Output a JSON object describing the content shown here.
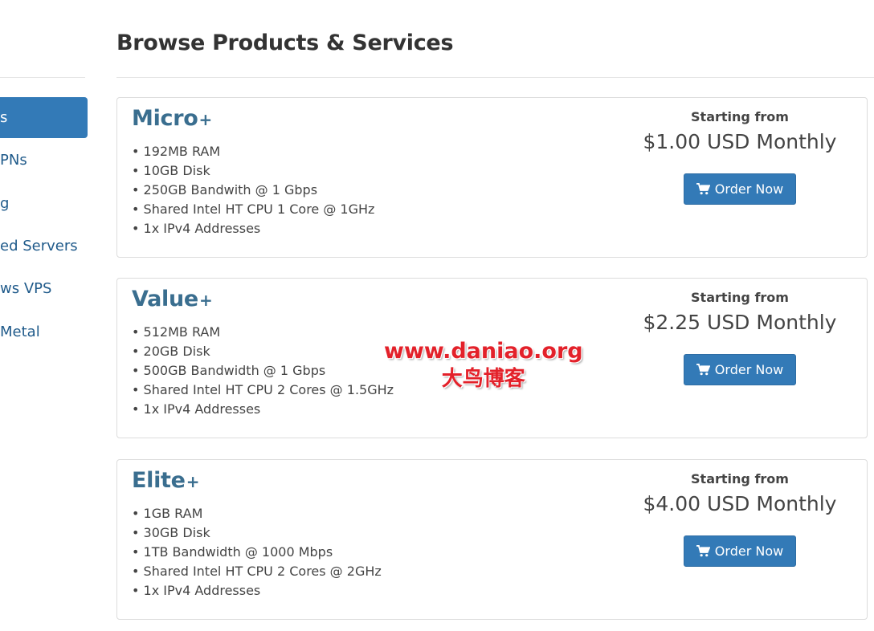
{
  "sidebar": {
    "items": [
      {
        "label": "s",
        "active": true
      },
      {
        "label": "PNs",
        "active": false
      },
      {
        "label": "g",
        "active": false
      },
      {
        "label": "ed Servers",
        "active": false
      },
      {
        "label": "ws VPS",
        "active": false
      },
      {
        "label": "Metal",
        "active": false
      }
    ]
  },
  "page": {
    "title": "Browse Products & Services"
  },
  "products": [
    {
      "name": "Micro",
      "name_suffix": "+",
      "features": [
        "192MB RAM",
        "10GB Disk",
        "250GB Bandwith @ 1 Gbps",
        "Shared Intel HT CPU 1 Core @ 1GHz",
        "1x IPv4 Addresses"
      ],
      "starting_label": "Starting from",
      "price": "$1.00 USD Monthly",
      "button_label": "Order Now"
    },
    {
      "name": "Value",
      "name_suffix": "+",
      "features": [
        "512MB RAM",
        "20GB Disk",
        "500GB Bandwidth @ 1 Gbps",
        "Shared Intel HT CPU 2 Cores @ 1.5GHz",
        "1x IPv4 Addresses"
      ],
      "starting_label": "Starting from",
      "price": "$2.25 USD Monthly",
      "button_label": "Order Now"
    },
    {
      "name": "Elite",
      "name_suffix": "+",
      "features": [
        "1GB RAM",
        "30GB Disk",
        "1TB Bandwidth @ 1000 Mbps",
        "Shared Intel HT CPU 2 Cores @ 2GHz",
        "1x IPv4 Addresses"
      ],
      "starting_label": "Starting from",
      "price": "$4.00 USD Monthly",
      "button_label": "Order Now"
    }
  ],
  "watermark": {
    "url": "www.daniao.org",
    "cn": "大鸟博客"
  },
  "colors": {
    "accent": "#337ab7",
    "product_title": "#3a6e8f",
    "watermark": "#e3212a"
  },
  "icons": {
    "order_button": "shopping-cart-icon"
  }
}
